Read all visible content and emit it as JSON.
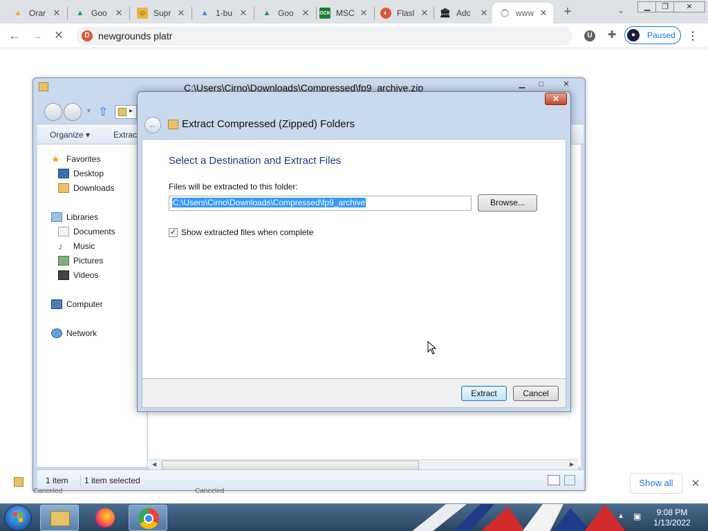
{
  "browser": {
    "tabs": [
      {
        "title": "Orar",
        "icon": "drive-icon"
      },
      {
        "title": "Goo",
        "icon": "drive-icon"
      },
      {
        "title": "Supr",
        "icon": "game-icon"
      },
      {
        "title": "1-bu",
        "icon": "drive-icon"
      },
      {
        "title": "Goo",
        "icon": "drive-icon"
      },
      {
        "title": "MSC",
        "icon": "ock-icon"
      },
      {
        "title": "Flasl",
        "icon": "duckduckgo-icon"
      },
      {
        "title": "Adc",
        "icon": "archive-icon"
      },
      {
        "title": "www",
        "icon": "loading-icon"
      }
    ],
    "new_tab": "+",
    "omnibox": "newgrounds platr",
    "profile_status": "Paused",
    "extension_u": "U"
  },
  "explorer": {
    "title": "C:\\Users\\Cirno\\Downloads\\Compressed\\fp9_archive.zip",
    "commands": {
      "organize": "Organize ▾",
      "extract": "Extract"
    },
    "nav": {
      "favorites": "Favorites",
      "desktop": "Desktop",
      "downloads": "Downloads",
      "libraries": "Libraries",
      "documents": "Documents",
      "music": "Music",
      "pictures": "Pictures",
      "videos": "Videos",
      "computer": "Computer",
      "network": "Network"
    },
    "status": {
      "count": "1 item",
      "selected": "1 item selected"
    }
  },
  "dialog": {
    "title": "Extract Compressed (Zipped) Folders",
    "heading": "Select a Destination and Extract Files",
    "folder_label": "Files will be extracted to this folder:",
    "path": "C:\\Users\\Cirno\\Downloads\\Compressed\\fp9_archive",
    "browse": "Browse...",
    "checkbox_label": "Show extracted files when complete",
    "checkbox_checked": true,
    "extract": "Extract",
    "cancel": "Cancel"
  },
  "shelf": {
    "show_all": "Show all",
    "items": [
      "Canceled",
      "Canceled"
    ]
  },
  "taskbar": {
    "time": "9:08 PM",
    "date": "1/13/2022"
  },
  "colors": {
    "dialog_heading": "#1e3a78",
    "selection": "#3399ff",
    "chrome_accent": "#1a73e8"
  }
}
